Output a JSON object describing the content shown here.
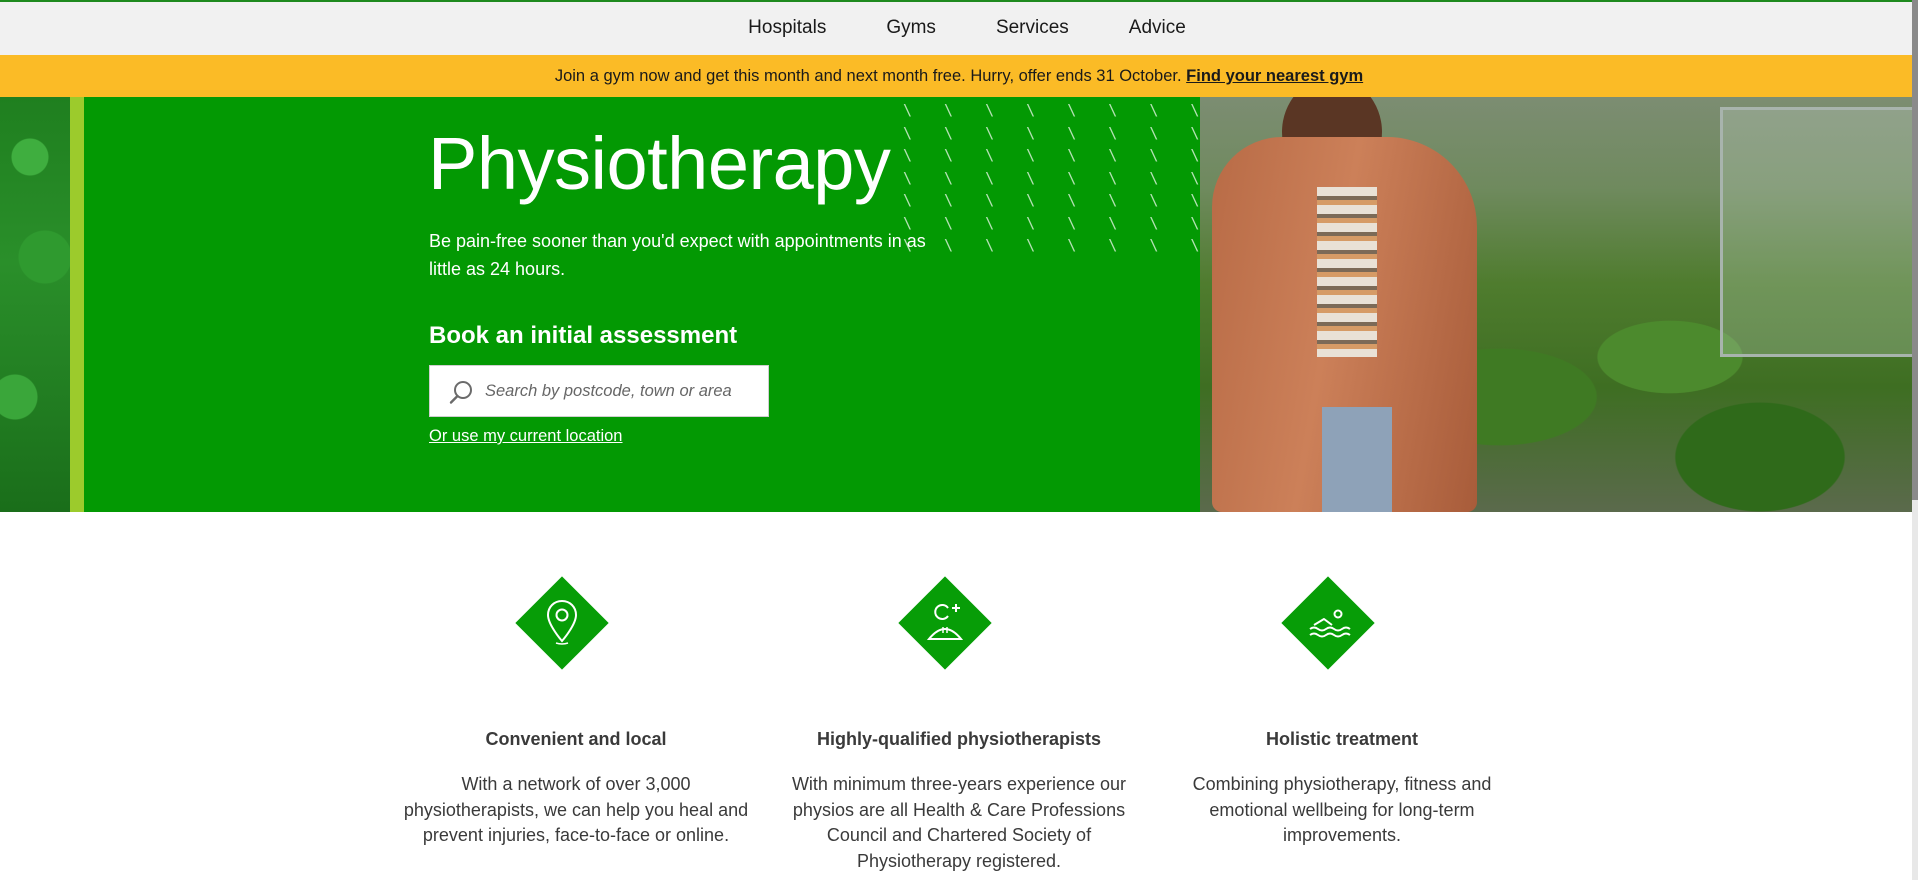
{
  "nav": {
    "items": [
      "Hospitals",
      "Gyms",
      "Services",
      "Advice"
    ]
  },
  "promo": {
    "text": "Join a gym now and get this month and next month free. Hurry, offer ends 31 October.",
    "link": "Find your nearest gym"
  },
  "hero": {
    "title": "Physiotherapy",
    "subtitle": "Be pain-free sooner than you'd expect with appointments in as little as 24 hours.",
    "book_heading": "Book an initial assessment",
    "search_placeholder": "Search by postcode, town or area",
    "location_link": "Or use my current location"
  },
  "features": [
    {
      "icon": "map-pin-icon",
      "title": "Convenient and local",
      "text": "With a network of over 3,000 physiotherapists, we can help you heal and prevent injuries, face-to-face or online."
    },
    {
      "icon": "add-person-icon",
      "title": "Highly-qualified physiotherapists",
      "text": "With minimum three-years experience our physios are all Health & Care Professions Council and Chartered Society of Physiotherapy registered."
    },
    {
      "icon": "swimmer-icon",
      "title": "Holistic treatment",
      "text": "Combining physiotherapy, fitness and emotional wellbeing for long-term improvements."
    }
  ],
  "colors": {
    "brand_green": "#039903",
    "promo_yellow": "#fbbb26",
    "accent_lime": "#9ccb2c"
  }
}
